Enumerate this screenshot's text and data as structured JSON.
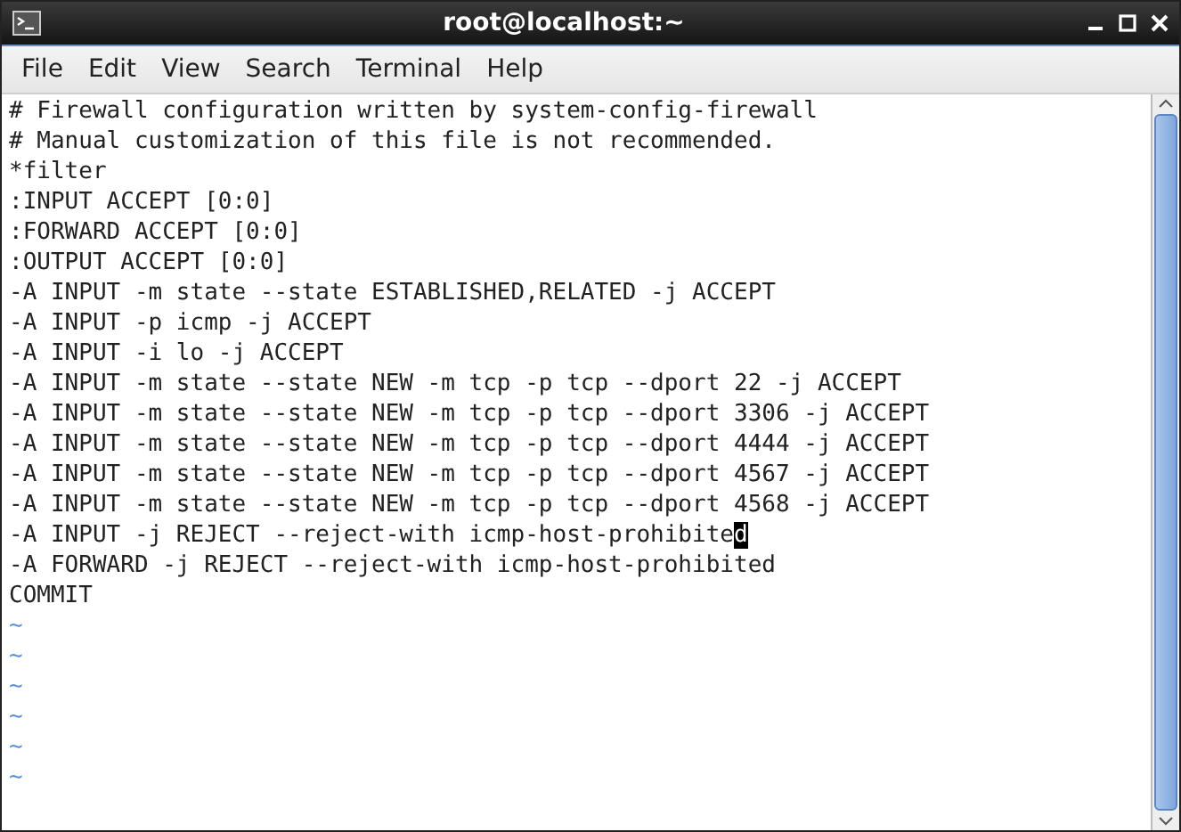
{
  "window": {
    "title": "root@localhost:~"
  },
  "menu": [
    {
      "label": "File"
    },
    {
      "label": "Edit"
    },
    {
      "label": "View"
    },
    {
      "label": "Search"
    },
    {
      "label": "Terminal"
    },
    {
      "label": "Help"
    }
  ],
  "lines": [
    {
      "kind": "text",
      "text": "# Firewall configuration written by system-config-firewall",
      "cursor": false
    },
    {
      "kind": "text",
      "text": "# Manual customization of this file is not recommended.",
      "cursor": false
    },
    {
      "kind": "text",
      "text": "*filter",
      "cursor": false
    },
    {
      "kind": "text",
      "text": ":INPUT ACCEPT [0:0]",
      "cursor": false
    },
    {
      "kind": "text",
      "text": ":FORWARD ACCEPT [0:0]",
      "cursor": false
    },
    {
      "kind": "text",
      "text": ":OUTPUT ACCEPT [0:0]",
      "cursor": false
    },
    {
      "kind": "text",
      "text": "-A INPUT -m state --state ESTABLISHED,RELATED -j ACCEPT",
      "cursor": false
    },
    {
      "kind": "text",
      "text": "-A INPUT -p icmp -j ACCEPT",
      "cursor": false
    },
    {
      "kind": "text",
      "text": "-A INPUT -i lo -j ACCEPT",
      "cursor": false
    },
    {
      "kind": "text",
      "text": "-A INPUT -m state --state NEW -m tcp -p tcp --dport 22 -j ACCEPT",
      "cursor": false
    },
    {
      "kind": "text",
      "text": "-A INPUT -m state --state NEW -m tcp -p tcp --dport 3306 -j ACCEPT",
      "cursor": false
    },
    {
      "kind": "text",
      "text": "-A INPUT -m state --state NEW -m tcp -p tcp --dport 4444 -j ACCEPT",
      "cursor": false
    },
    {
      "kind": "text",
      "text": "-A INPUT -m state --state NEW -m tcp -p tcp --dport 4567 -j ACCEPT",
      "cursor": false
    },
    {
      "kind": "text",
      "text": "-A INPUT -m state --state NEW -m tcp -p tcp --dport 4568 -j ACCEPT",
      "cursor": false
    },
    {
      "kind": "text",
      "text": "-A INPUT -j REJECT --reject-with icmp-host-prohibited",
      "cursor": true
    },
    {
      "kind": "text",
      "text": "-A FORWARD -j REJECT --reject-with icmp-host-prohibited",
      "cursor": false
    },
    {
      "kind": "text",
      "text": "COMMIT",
      "cursor": false
    },
    {
      "kind": "filler",
      "text": "~",
      "cursor": false
    },
    {
      "kind": "filler",
      "text": "~",
      "cursor": false
    },
    {
      "kind": "filler",
      "text": "~",
      "cursor": false
    },
    {
      "kind": "filler",
      "text": "~",
      "cursor": false
    },
    {
      "kind": "filler",
      "text": "~",
      "cursor": false
    },
    {
      "kind": "filler",
      "text": "~",
      "cursor": false
    }
  ]
}
